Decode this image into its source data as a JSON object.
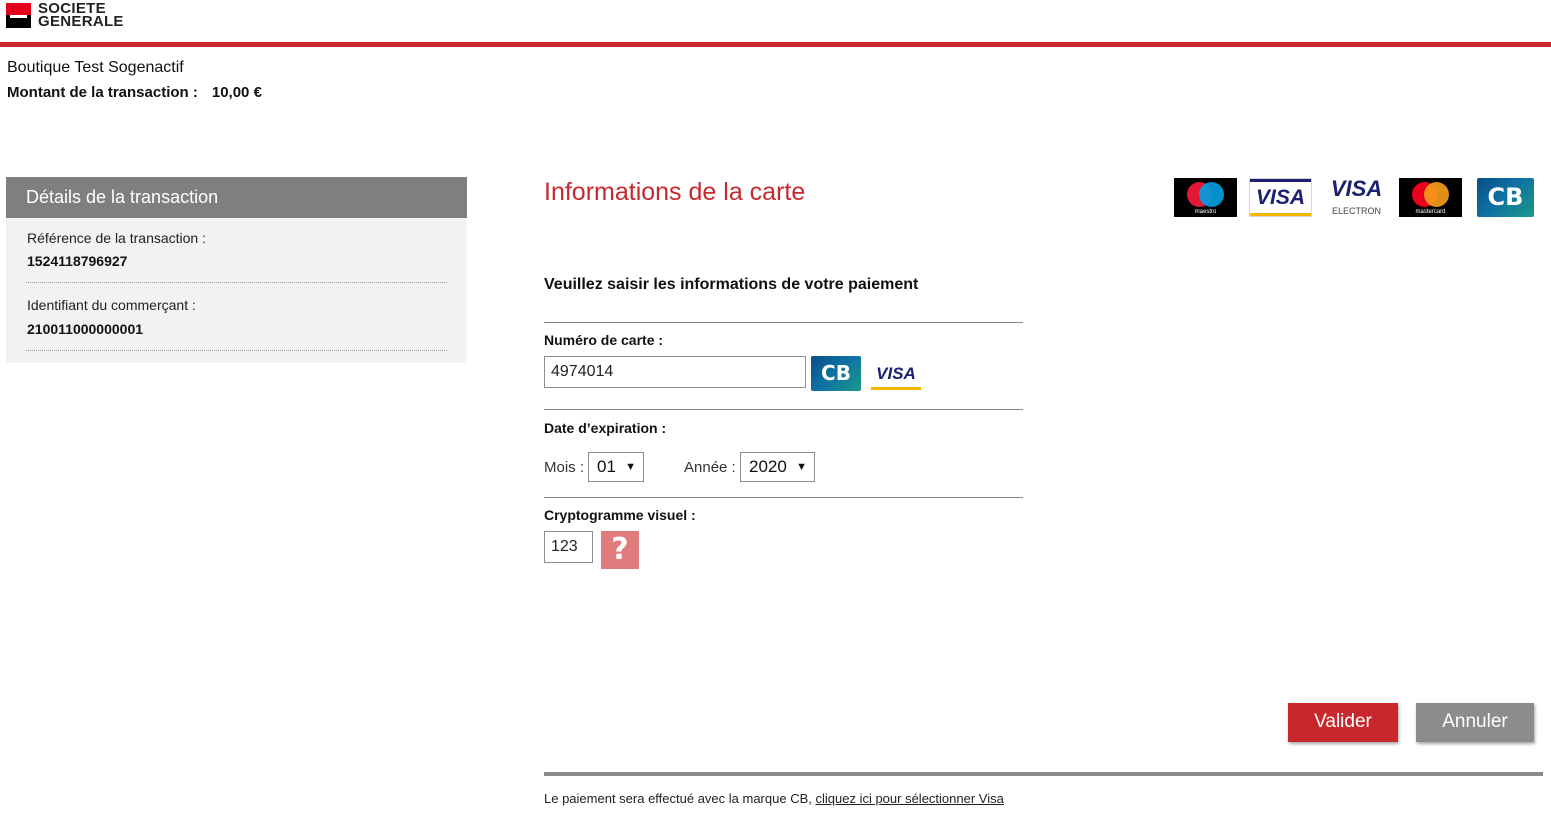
{
  "brand": {
    "logo_text": "SOCIETE GENERALE",
    "accent_color": "#c8282d"
  },
  "shop": {
    "name": "Boutique Test Sogenactif",
    "amount_label": "Montant de la transaction :",
    "amount_value": "10,00 €"
  },
  "details": {
    "title": "Détails de la transaction",
    "reference_label": "Référence de la transaction :",
    "reference_value": "1524118796927",
    "merchant_label": "Identifiant du commerçant :",
    "merchant_value": "210011000000001"
  },
  "card_form": {
    "title": "Informations de la carte",
    "instructions": "Veuillez saisir les informations de votre paiement",
    "card_number_label": "Numéro de carte :",
    "card_number_value": "4974014",
    "expiry_label": "Date d’expiration :",
    "month_label": "Mois :",
    "month_value": "01",
    "year_label": "Année :",
    "year_value": "2020",
    "cvv_label": "Cryptogramme visuel :",
    "cvv_value": "123",
    "help_icon": "?"
  },
  "accepted_cards": [
    "maestro",
    "visa",
    "visa electron",
    "mastercard",
    "cb"
  ],
  "card_logo_text": {
    "maestro": "maestro",
    "visa": "VISA",
    "visa_electron": "ELECTRON",
    "mastercard": "mastercard",
    "cb": "CB"
  },
  "buttons": {
    "validate": "Valider",
    "cancel": "Annuler"
  },
  "footer": {
    "text": "Le paiement sera effectué avec la marque CB,",
    "link": "cliquez ici pour sélectionner Visa"
  }
}
